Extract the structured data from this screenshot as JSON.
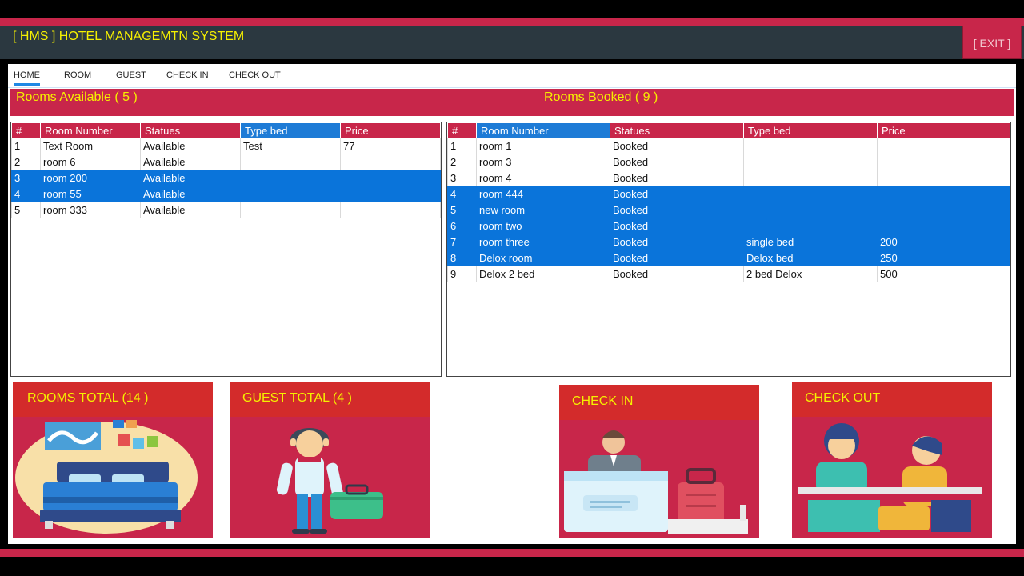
{
  "app": {
    "title": "[ HMS ] HOTEL MANAGEMTN SYSTEM",
    "exit_label": "[ EXIT ]"
  },
  "tabs": [
    {
      "label": "HOME",
      "active": true
    },
    {
      "label": "ROOM"
    },
    {
      "label": "GUEST"
    },
    {
      "label": "CHECK IN"
    },
    {
      "label": "CHECK OUT"
    }
  ],
  "banner": {
    "available_label": "Rooms Available ( 5 )",
    "booked_label": "Rooms Booked ( 9 )"
  },
  "available_table": {
    "headers": [
      "#",
      "Room Number",
      "Statues",
      "Type bed",
      "Price"
    ],
    "rows": [
      {
        "cells": [
          "1",
          "Text Room",
          "Available",
          "Test",
          "77"
        ],
        "selected": false
      },
      {
        "cells": [
          "2",
          "room 6",
          "Available",
          "",
          ""
        ],
        "selected": false
      },
      {
        "cells": [
          "3",
          "room 200",
          "Available",
          "",
          ""
        ],
        "selected": true
      },
      {
        "cells": [
          "4",
          "room 55",
          "Available",
          "",
          ""
        ],
        "selected": true
      },
      {
        "cells": [
          "5",
          "room 333",
          "Available",
          "",
          ""
        ],
        "selected": false
      }
    ]
  },
  "booked_table": {
    "headers": [
      "#",
      "Room Number",
      "Statues",
      "Type bed",
      "Price"
    ],
    "rows": [
      {
        "cells": [
          "1",
          "room 1",
          "Booked",
          "",
          ""
        ],
        "selected": false
      },
      {
        "cells": [
          "2",
          "room 3",
          "Booked",
          "",
          ""
        ],
        "selected": false
      },
      {
        "cells": [
          "3",
          "room 4",
          "Booked",
          "",
          ""
        ],
        "selected": false
      },
      {
        "cells": [
          "4",
          "room 444",
          "Booked",
          "",
          ""
        ],
        "selected": true
      },
      {
        "cells": [
          "5",
          "new room",
          "Booked",
          "",
          ""
        ],
        "selected": true
      },
      {
        "cells": [
          "6",
          "room two",
          "Booked",
          "",
          ""
        ],
        "selected": true
      },
      {
        "cells": [
          "7",
          "room three",
          "Booked",
          "single bed",
          "200"
        ],
        "selected": true
      },
      {
        "cells": [
          "8",
          "Delox room",
          "Booked",
          "Delox bed",
          "250"
        ],
        "selected": true
      },
      {
        "cells": [
          "9",
          "Delox 2 bed",
          "Booked",
          "2 bed Delox",
          "500"
        ],
        "selected": false
      }
    ]
  },
  "cards": {
    "rooms_total": "ROOMS TOTAL  (14  )",
    "guest_total": "GUEST TOTAL (4 )",
    "check_in": "CHECK IN",
    "check_out": "CHECK OUT"
  },
  "colors": {
    "accent": "#c8264a",
    "selection": "#0a74da",
    "title_text": "#f5f000",
    "titlebar": "#2b3840"
  }
}
